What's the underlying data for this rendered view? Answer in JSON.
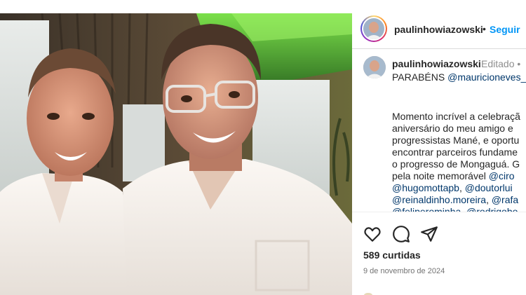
{
  "post": {
    "username": "paulinhowiazowski",
    "follow_label": "Seguir",
    "dot": "•",
    "edited_label": "Editado •",
    "caption_lines": [
      [
        {
          "t": "PARABÉNS ",
          "m": false
        },
        {
          "t": "@mauricioneves_",
          "m": true
        }
      ],
      [],
      [
        {
          "t": "Momento incrível a celebraçã",
          "m": false
        }
      ],
      [
        {
          "t": "aniversário do meu amigo e",
          "m": false
        }
      ],
      [
        {
          "t": "progressistas Mané, e oportu",
          "m": false
        }
      ],
      [
        {
          "t": "encontrar parceiros fundame",
          "m": false
        }
      ],
      [
        {
          "t": "o progresso de Mongaguá. G",
          "m": false
        }
      ],
      [
        {
          "t": "pela noite memorável ",
          "m": false
        },
        {
          "t": "@ciro",
          "m": true
        }
      ],
      [
        {
          "t": "@hugomottapb",
          "m": true
        },
        {
          "t": ", ",
          "m": false
        },
        {
          "t": "@doutorlui",
          "m": true
        }
      ],
      [
        {
          "t": "@reinaldinho.moreira",
          "m": true
        },
        {
          "t": ", ",
          "m": false
        },
        {
          "t": "@rafa",
          "m": true
        }
      ],
      [
        {
          "t": "@feliperominha",
          "m": true
        },
        {
          "t": ", ",
          "m": false
        },
        {
          "t": "@rodrigobo",
          "m": true
        }
      ]
    ],
    "likes_text": "589 curtidas",
    "date_text": "9 de novembro de 2024",
    "icons": [
      "heart-icon",
      "comment-icon",
      "share-icon"
    ],
    "colors": {
      "link": "#0095f6",
      "mention": "#00376b",
      "text": "#262626",
      "muted": "#737373"
    }
  }
}
